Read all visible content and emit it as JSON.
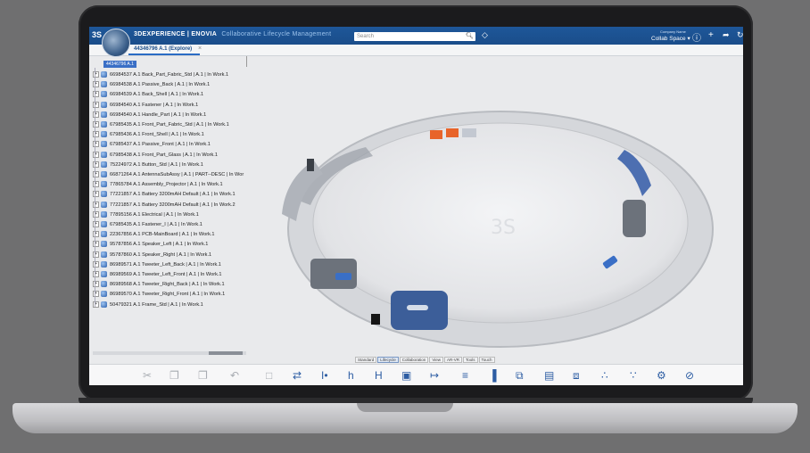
{
  "app": {
    "brand": "3DEXPERIENCE | ENOVIA",
    "brand_sub": "Collaborative Lifecycle Management",
    "logo_text": "3S",
    "search_placeholder": "Search",
    "space_label": "Collab Space",
    "space_top": "Company Name"
  },
  "tab": {
    "label": "44346796 A.1 (Explore)",
    "close": "×"
  },
  "tree": {
    "root": "44346796 A.1",
    "items": [
      "66984537 A.1  Back_Part_Fabric_Std  | A.1 | In Work.1",
      "66984538 A.1  Passive_Back  | A.1 | In Work.1",
      "66984539 A.1  Back_Shell  | A.1 | In Work.1",
      "66984540 A.1  Fastener  | A.1 | In Work.1",
      "66984540 A.1  Handle_Part  | A.1 | In Work.1",
      "67985435 A.1  Front_Part_Fabric_Std  | A.1 | In Work.1",
      "67985436 A.1  Front_Shell  | A.1 | In Work.1",
      "67985437 A.1  Passive_Front  | A.1 | In Work.1",
      "67985438 A.1  Front_Part_Glass  | A.1 | In Work.1",
      "75224972 A.1  Button_Std  | A.1 | In Work.1",
      "66871264 A.1  AntennaSubAssy  | A.1 | PART--DESC | In Wor",
      "77865784 A.1  Assembly_Projector  | A.1 | In Work.1",
      "77221857 A.1  Battery 3200mAH Default  | A.1 | In Work.1",
      "77221857 A.1  Battery 3200mAH Default  | A.1 | In Work.2",
      "77895156 A.1  Electrical  | A.1 | In Work.1",
      "67985435 A.1  Fastener_I  | A.1 | In Work.1",
      "22367856 A.1  PCB-MainBoard  | A.1 | In Work.1",
      "95787856 A.1  Speaker_Left  | A.1 | In Work.1",
      "95787860 A.1  Speaker_Right  | A.1 | In Work.1",
      "86989571 A.1  Tweeter_Left_Back  | A.1 | In Work.1",
      "86989569 A.1  Tweeter_Left_Front  | A.1 | In Work.1",
      "86989568 A.1  Tweeter_Right_Back  | A.1 | In Work.1",
      "86989570 A.1  Tweeter_Right_Front  | A.1 | In Work.1",
      "50479321 A.1  Frame_Std  | A.1 | In Work.1"
    ]
  },
  "action_tabs": [
    "Standard",
    "Lifecycle",
    "Collaboration",
    "View",
    "AR-VR",
    "Tools",
    "Touch"
  ],
  "active_action_tab": "Lifecycle",
  "colors": {
    "topbar": "#1e5799",
    "accent": "#2a6cc4",
    "model_orange": "#e8642a",
    "model_blue": "#3a6fc6"
  }
}
